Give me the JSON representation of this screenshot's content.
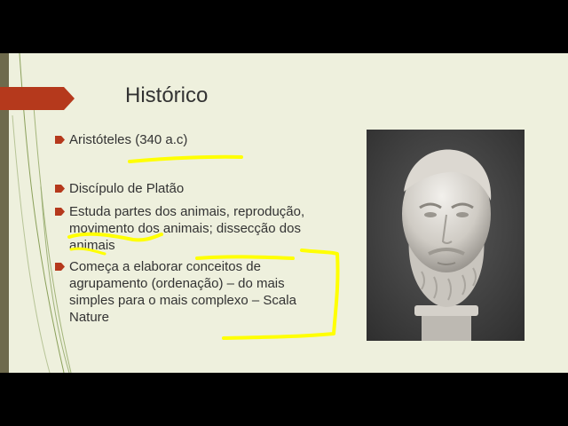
{
  "slide": {
    "title": "Histórico",
    "bullets": [
      {
        "text": "Aristóteles (340 a.c)"
      },
      {
        "text": "Discípulo de Platão"
      },
      {
        "text": "Estuda partes dos animais, reprodução, movimento dos animais; dissecção dos animais"
      },
      {
        "text": "Começa a elaborar conceitos de agrupamento (ordenação) – do mais simples para o mais complexo – Scala Nature"
      }
    ]
  },
  "colors": {
    "background": "#eef0dd",
    "ribbon": "#b5391c",
    "bullet_arrow": "#b5391c",
    "highlight": "#ffff00",
    "text": "#333333",
    "left_bar": "#6e6a4c"
  },
  "images": {
    "portrait": "marble-bust-of-bearded-man"
  }
}
